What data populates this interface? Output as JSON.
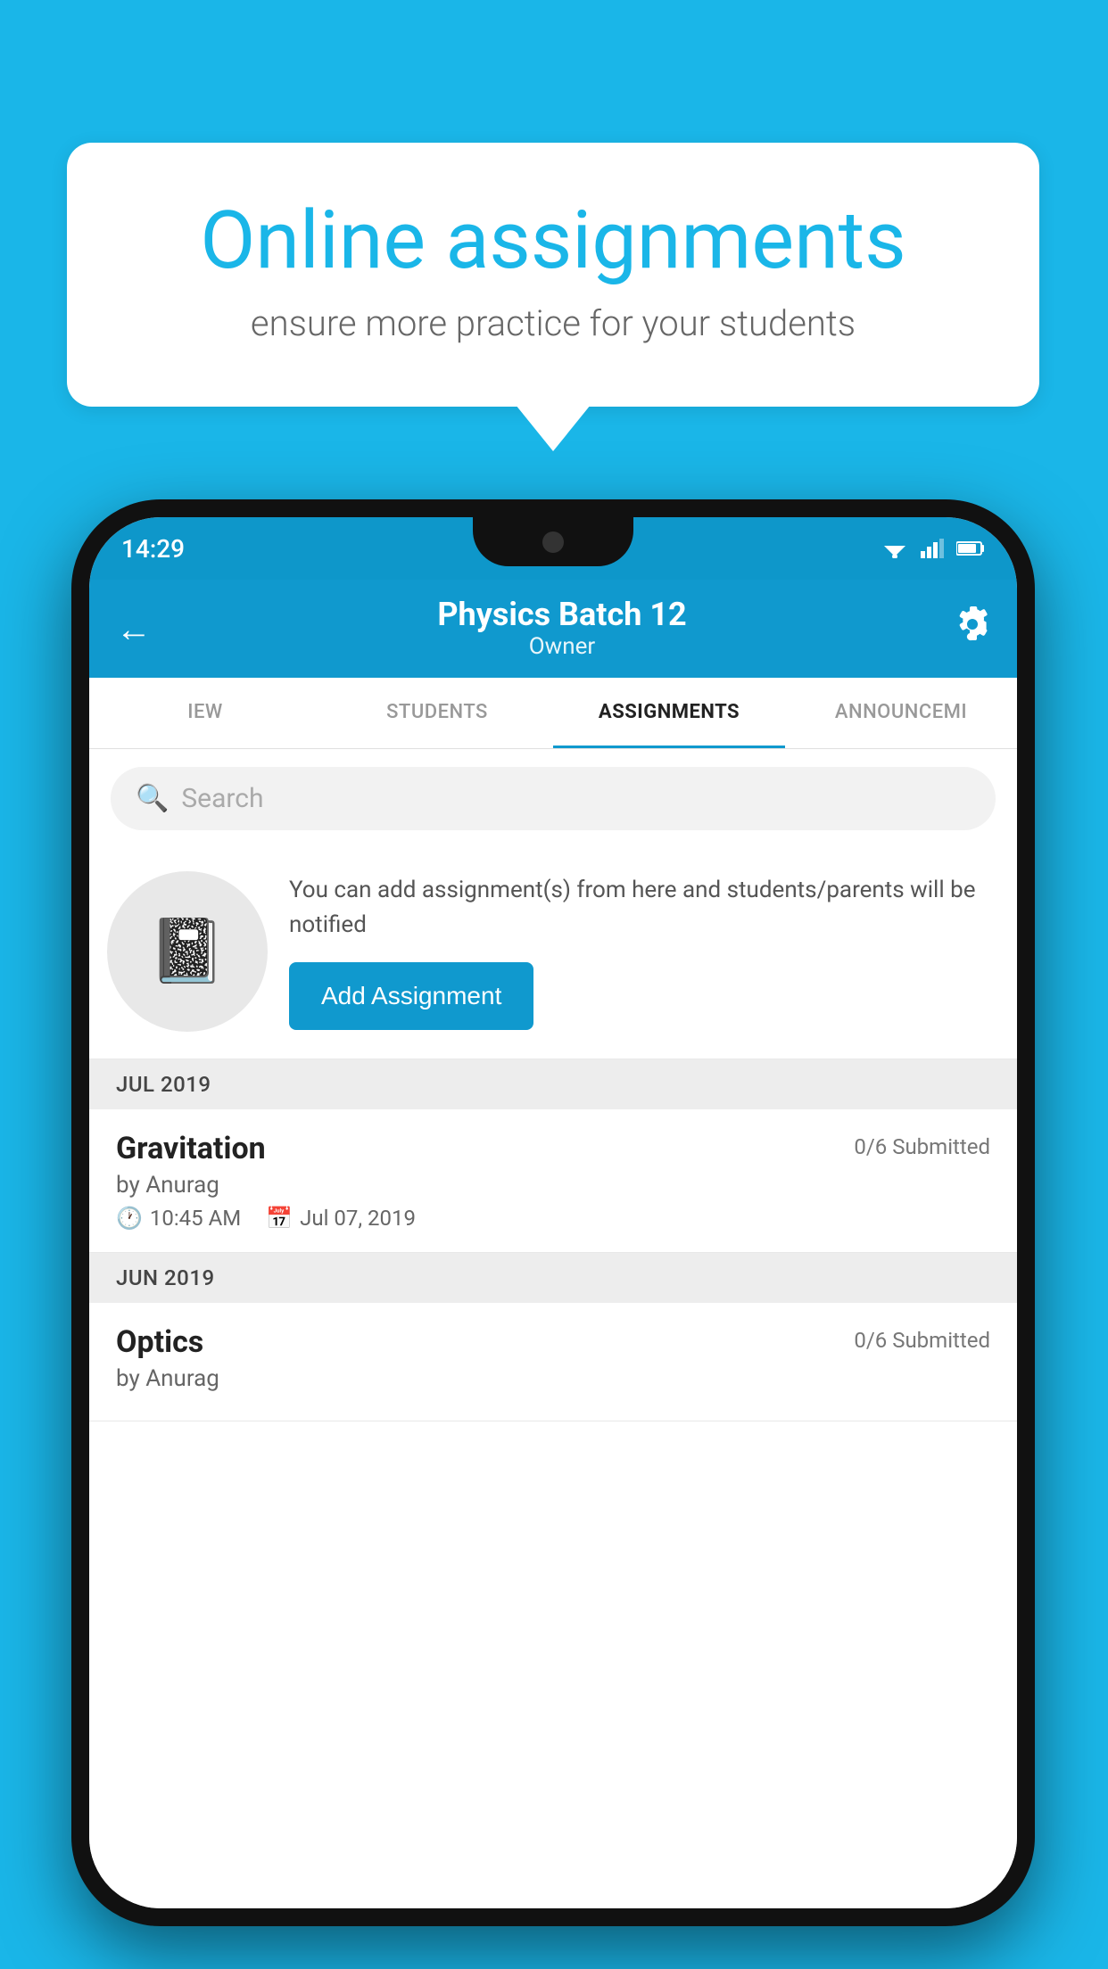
{
  "background_color": "#1ab6e8",
  "speech_bubble": {
    "title": "Online assignments",
    "subtitle": "ensure more practice for your students"
  },
  "phone": {
    "status_bar": {
      "time": "14:29"
    },
    "header": {
      "title": "Physics Batch 12",
      "subtitle": "Owner",
      "back_label": "←",
      "settings_label": "⚙"
    },
    "tabs": [
      {
        "label": "IEW",
        "active": false
      },
      {
        "label": "STUDENTS",
        "active": false
      },
      {
        "label": "ASSIGNMENTS",
        "active": true
      },
      {
        "label": "ANNOUNCEMI",
        "active": false
      }
    ],
    "search": {
      "placeholder": "Search"
    },
    "promo": {
      "description": "You can add assignment(s) from here and students/parents will be notified",
      "button_label": "Add Assignment"
    },
    "sections": [
      {
        "month": "JUL 2019",
        "assignments": [
          {
            "name": "Gravitation",
            "submitted": "0/6 Submitted",
            "by": "by Anurag",
            "time": "10:45 AM",
            "date": "Jul 07, 2019"
          }
        ]
      },
      {
        "month": "JUN 2019",
        "assignments": [
          {
            "name": "Optics",
            "submitted": "0/6 Submitted",
            "by": "by Anurag",
            "time": "",
            "date": ""
          }
        ]
      }
    ]
  }
}
